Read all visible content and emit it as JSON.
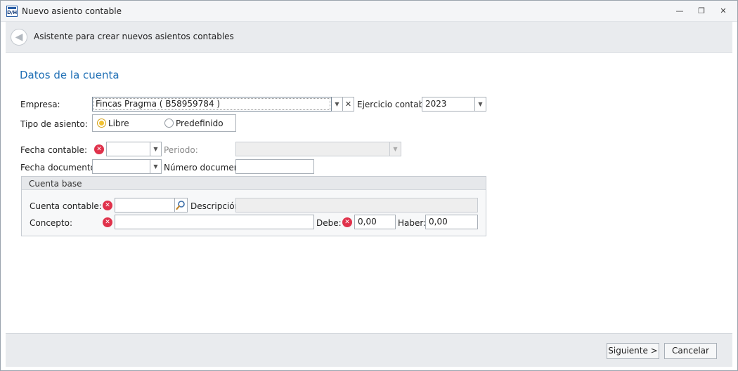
{
  "window": {
    "title": "Nuevo asiento contable",
    "icon_text": "D/H",
    "minimize_glyph": "—",
    "restore_glyph": "❐",
    "close_glyph": "✕"
  },
  "wizard": {
    "title": "Asistente para crear nuevos asientos contables",
    "back_glyph": "◀"
  },
  "section": {
    "title": "Datos de la cuenta"
  },
  "form": {
    "empresa": {
      "label": "Empresa:",
      "value": "Fincas Pragma ( B58959784 )"
    },
    "ejercicio": {
      "label": "Ejercicio contable:",
      "value": "2023"
    },
    "tipo_asiento": {
      "label": "Tipo de asiento:",
      "options": [
        "Libre",
        "Predefinido"
      ],
      "selected": "Libre"
    },
    "fecha_contable": {
      "label": "Fecha contable:",
      "value": ""
    },
    "periodo": {
      "label": "Periodo:",
      "value": ""
    },
    "fecha_documento": {
      "label": "Fecha documento:",
      "value": ""
    },
    "numero_documento": {
      "label": "Número documento:",
      "value": ""
    }
  },
  "cuenta_base": {
    "title": "Cuenta base",
    "cuenta_contable": {
      "label": "Cuenta contable:",
      "value": ""
    },
    "descripcion": {
      "label": "Descripción:",
      "value": ""
    },
    "concepto": {
      "label": "Concepto:",
      "value": ""
    },
    "debe": {
      "label": "Debe:",
      "value": "0,00"
    },
    "haber": {
      "label": "Haber:",
      "value": "0,00"
    }
  },
  "footer": {
    "next_label": "Siguiente >",
    "cancel_label": "Cancelar"
  },
  "glyphs": {
    "dropdown": "▼",
    "clear": "✕",
    "error": "✕"
  },
  "colors": {
    "accent": "#1f6fb5",
    "error": "#e0324b",
    "radio_selected": "#f2c12e"
  }
}
